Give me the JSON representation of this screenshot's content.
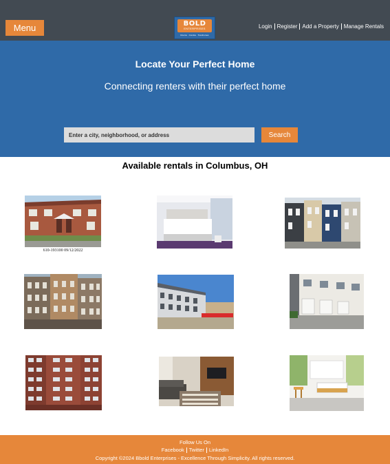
{
  "header": {
    "menu_label": "Menu",
    "logo": {
      "word": "BOLD",
      "sub": "ENTERPRISES",
      "tagline": "Rooms · Condos · Townhomes"
    },
    "nav": [
      "Login",
      "Register",
      "Add a Property",
      "Manage Rentals"
    ]
  },
  "hero": {
    "title": "Locate Your Perfect Home",
    "subtitle": "Connecting renters with their perfect home",
    "search_placeholder": "Enter a city, neighborhood, or address",
    "search_button": "Search"
  },
  "listings": {
    "heading": "Available rentals in Columbus, OH",
    "items": [
      {
        "image": "brick-townhouses",
        "caption": "610-193100 09/12/2022"
      },
      {
        "image": "white-bedroom"
      },
      {
        "image": "victorian-row-houses"
      },
      {
        "image": "old-apartment-facades"
      },
      {
        "image": "new-townhouse-construction"
      },
      {
        "image": "modern-townhomes-garages"
      },
      {
        "image": "high-rise-brick-apartments"
      },
      {
        "image": "living-room-sofa"
      },
      {
        "image": "bright-kitchen"
      }
    ]
  },
  "footer": {
    "follow": "Follow Us On",
    "social": [
      "Facebook",
      "Twitter",
      "LinkedIn"
    ],
    "copyright": "Copyright ©2024 Bbold Enterprises - Excellence Through Simplicity. All rights reserved."
  },
  "colors": {
    "header_bg": "#424a52",
    "hero_bg": "#2f6aa8",
    "accent": "#e6873a"
  }
}
